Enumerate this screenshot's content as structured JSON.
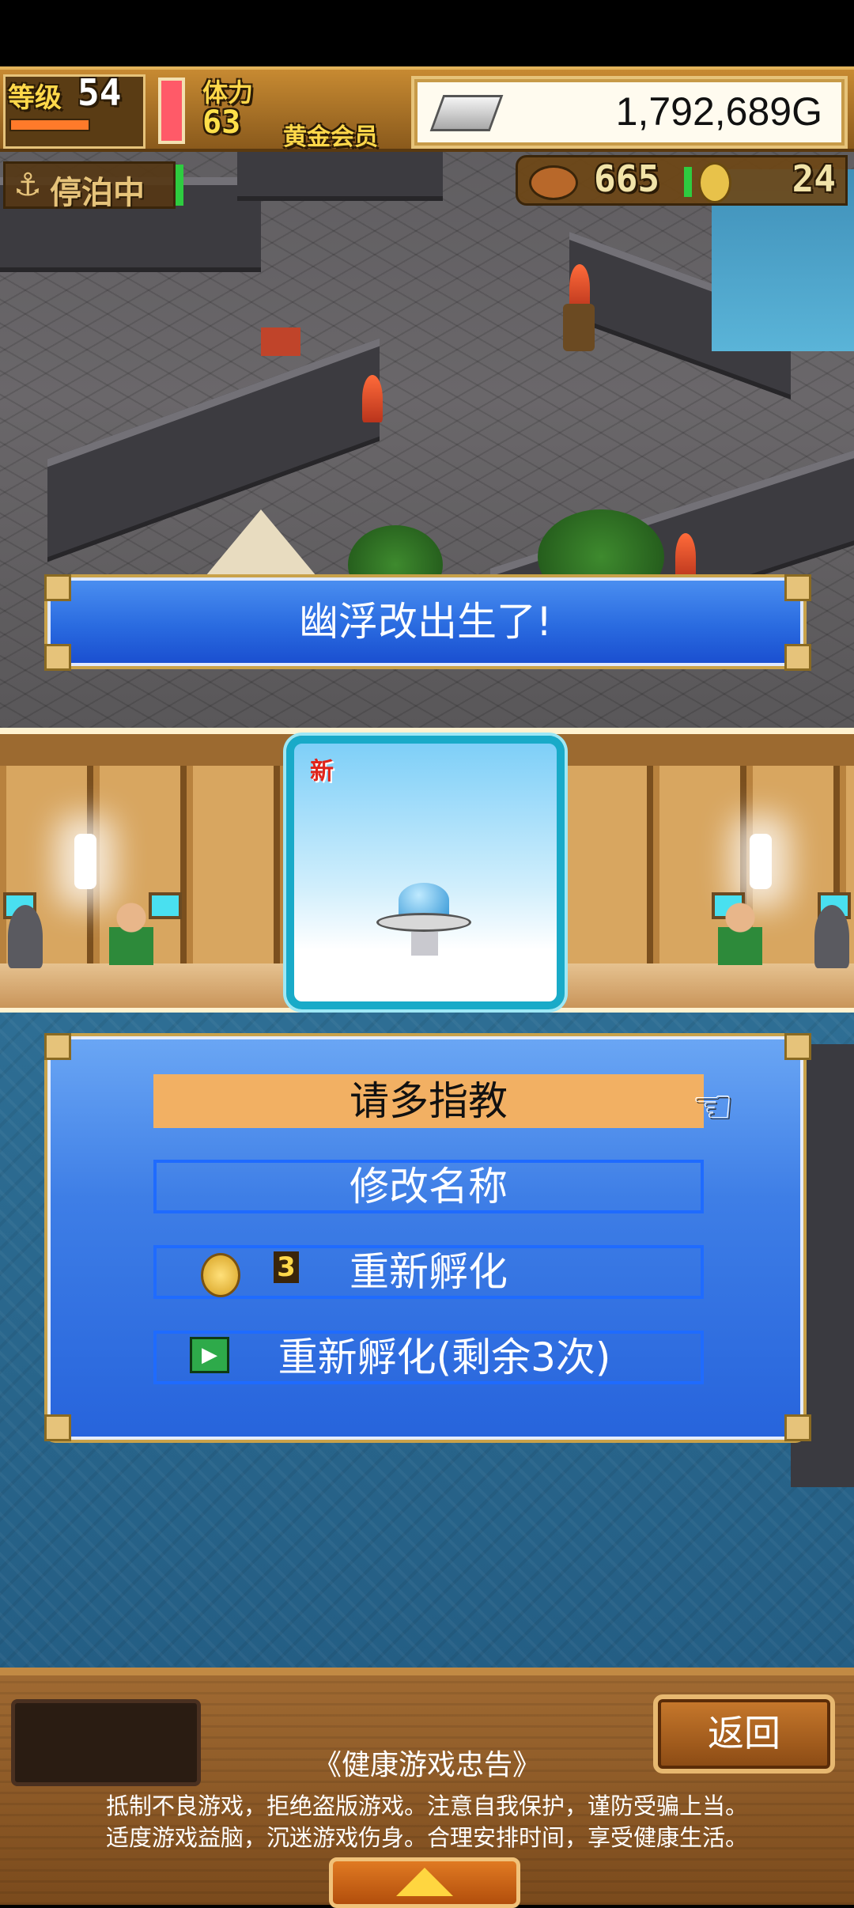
{
  "hud": {
    "level_label": "等级",
    "level_value": "54",
    "stamina_label": "体力",
    "stamina_value": "63",
    "member_label": "黄金会员",
    "money": "1,792,689G",
    "money_icon": "silver-bar-icon",
    "status_label": "停泊中",
    "status_icon": "anchor-icon",
    "food_icon": "meat-icon",
    "food_value": "665",
    "coin_icon": "coin-icon",
    "coin_value": "24"
  },
  "banner": {
    "text": "幽浮改出生了!"
  },
  "card": {
    "badge": "新",
    "item_icon": "ufo-icon"
  },
  "menu": {
    "items": [
      {
        "label": "请多指教",
        "selected": true
      },
      {
        "label": "修改名称",
        "selected": false
      },
      {
        "label": "重新孵化",
        "cost": "3",
        "cost_icon": "coin-icon"
      },
      {
        "label": "重新孵化(剩余3次)",
        "icon": "video-ad-icon"
      }
    ],
    "pointer_icon": "pointing-hand-icon"
  },
  "bottom": {
    "back_label": "返回",
    "notice_title": "《健康游戏忠告》",
    "notice_line1": "抵制不良游戏，拒绝盗版游戏。注意自我保护，谨防受骗上当。",
    "notice_line2": "适度游戏益脑，沉迷游戏伤身。合理安排时间，享受健康生活。",
    "expand_icon": "up-arrow-icon"
  },
  "colors": {
    "accent_blue": "#2a6be0",
    "selected_item": "#f2b063",
    "gold_frame": "#c9a24a"
  }
}
